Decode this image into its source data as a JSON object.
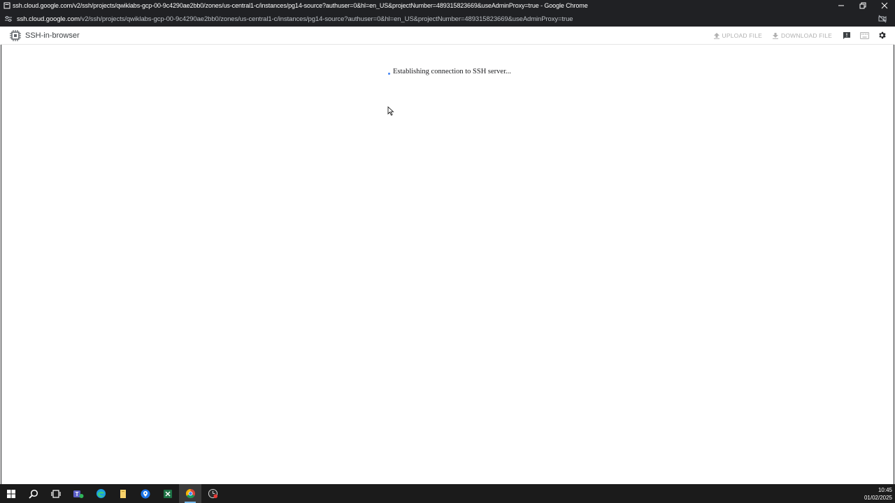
{
  "window": {
    "title": "ssh.cloud.google.com/v2/ssh/projects/qwiklabs-gcp-00-9c4290ae2bb0/zones/us-central1-c/instances/pg14-source?authuser=0&hl=en_US&projectNumber=489315823669&useAdminProxy=true - Google Chrome"
  },
  "urlbar": {
    "host": "ssh.cloud.google.com",
    "path": "/v2/ssh/projects/qwiklabs-gcp-00-9c4290ae2bb0/zones/us-central1-c/instances/pg14-source?authuser=0&hl=en_US&projectNumber=489315823669&useAdminProxy=true"
  },
  "header": {
    "title": "SSH-in-browser",
    "upload_label": "UPLOAD FILE",
    "download_label": "DOWNLOAD FILE"
  },
  "main": {
    "status": "Establishing connection to SSH server..."
  },
  "taskbar": {
    "time": "10:45",
    "date": "01/02/2025",
    "apps": [
      "start-icon",
      "search-icon",
      "task-view-icon",
      "teams-icon",
      "edge-icon",
      "file-explorer-icon",
      "maps-icon",
      "excel-icon",
      "chrome-icon",
      "app-icon"
    ]
  },
  "colors": {
    "titlebar_bg": "#202124",
    "taskbar_bg": "#1b1b1b",
    "accent_blue": "#4285f4"
  }
}
